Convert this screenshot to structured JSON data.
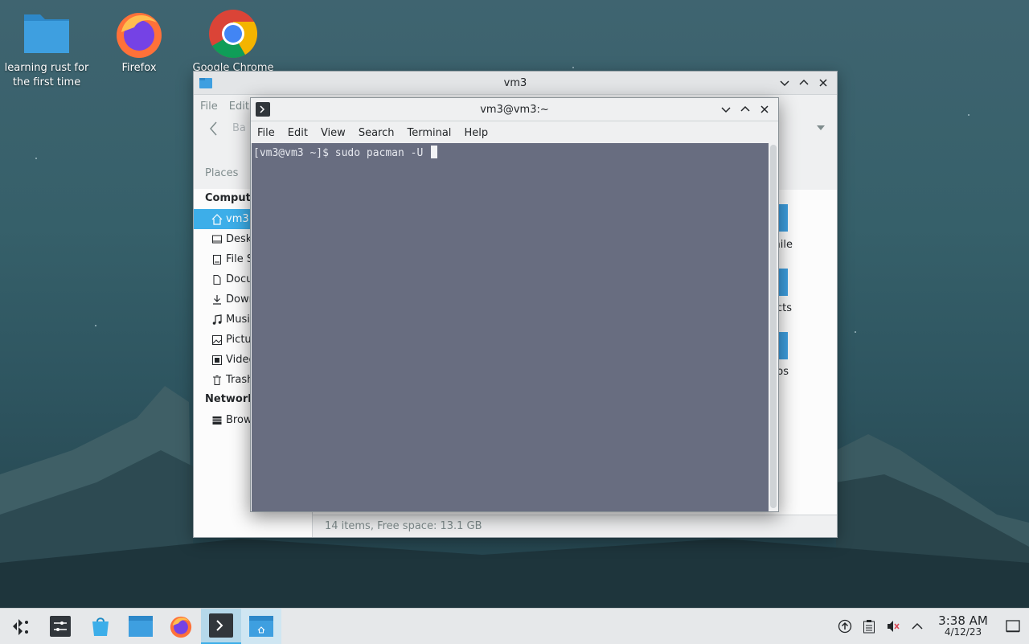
{
  "desktop": {
    "icons": [
      {
        "label": "learning rust for the first time"
      },
      {
        "label": "Firefox"
      },
      {
        "label": "Google Chrome"
      }
    ]
  },
  "dolphin": {
    "title": "vm3",
    "menu": [
      "File",
      "Edit"
    ],
    "nav_back_label": "Ba",
    "places_label": "Places",
    "sidebar": {
      "computer_heading": "Compute",
      "items": [
        {
          "label": "vm3",
          "icon": "home-icon"
        },
        {
          "label": "Desk",
          "icon": "desktop-icon"
        },
        {
          "label": "File S",
          "icon": "filesystem-icon"
        },
        {
          "label": "Docu",
          "icon": "document-icon"
        },
        {
          "label": "Dowr",
          "icon": "download-icon"
        },
        {
          "label": "Music",
          "icon": "music-icon"
        },
        {
          "label": "Pictur",
          "icon": "picture-icon"
        },
        {
          "label": "Video",
          "icon": "video-icon"
        },
        {
          "label": "Trash",
          "icon": "trash-icon"
        }
      ],
      "network_heading": "Network",
      "network_items": [
        {
          "label": "Brow",
          "icon": "network-icon"
        }
      ]
    },
    "partial_labels": [
      "nile",
      "cts",
      "os"
    ],
    "status": "14 items, Free space: 13.1 GB"
  },
  "terminal": {
    "title": "vm3@vm3:~",
    "menu": [
      "File",
      "Edit",
      "View",
      "Search",
      "Terminal",
      "Help"
    ],
    "prompt_line": "[vm3@vm3 ~]$ sudo pacman -U "
  },
  "taskbar": {
    "clock_time": "3:38 AM",
    "clock_date": "4/12/23"
  },
  "colors": {
    "accent": "#3daee9",
    "terminal_bg": "#686d80",
    "folder": "#3e9fe0"
  }
}
